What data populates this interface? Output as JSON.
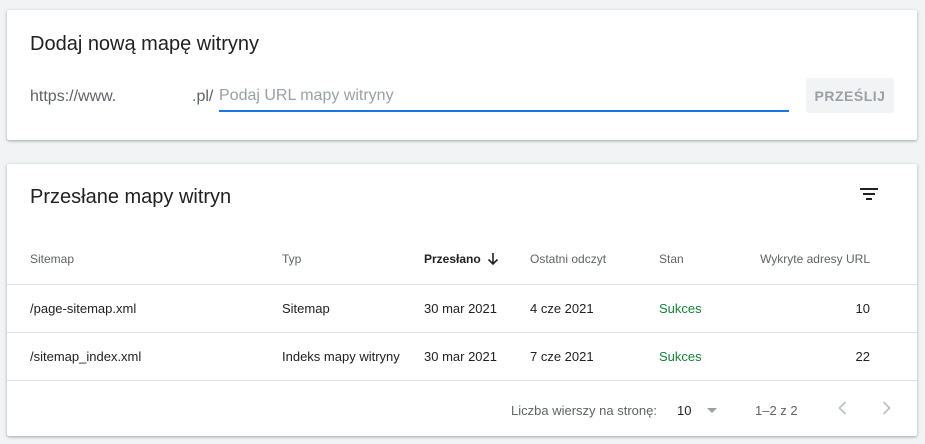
{
  "add_card": {
    "title": "Dodaj nową mapę witryny",
    "prefix": "https://www.",
    "suffix": ".pl/",
    "input_placeholder": "Podaj URL mapy witryny",
    "input_value": "",
    "submit_label": "PRZEŚLIJ"
  },
  "list_card": {
    "title": "Przesłane mapy witryn",
    "columns": [
      "Sitemap",
      "Typ",
      "Przesłano",
      "Ostatni odczyt",
      "Stan",
      "Wykryte adresy URL"
    ],
    "rows": [
      [
        "/page-sitemap.xml",
        "Sitemap",
        "30 mar 2021",
        "4 cze 2021",
        "Sukces",
        "10"
      ],
      [
        "/sitemap_index.xml",
        "Indeks mapy witryny",
        "30 mar 2021",
        "7 cze 2021",
        "Sukces",
        "22"
      ]
    ],
    "footer": {
      "rows_per_page_label": "Liczba wierszy na stronę:",
      "rows_per_page_value": "10",
      "range": "1–2 z 2"
    }
  },
  "colors": {
    "accent": "#1a73e8",
    "success": "#188038"
  },
  "icons": [
    "filter-icon",
    "arrow-down-icon",
    "chevron-down-icon",
    "chevron-left-icon",
    "chevron-right-icon"
  ]
}
